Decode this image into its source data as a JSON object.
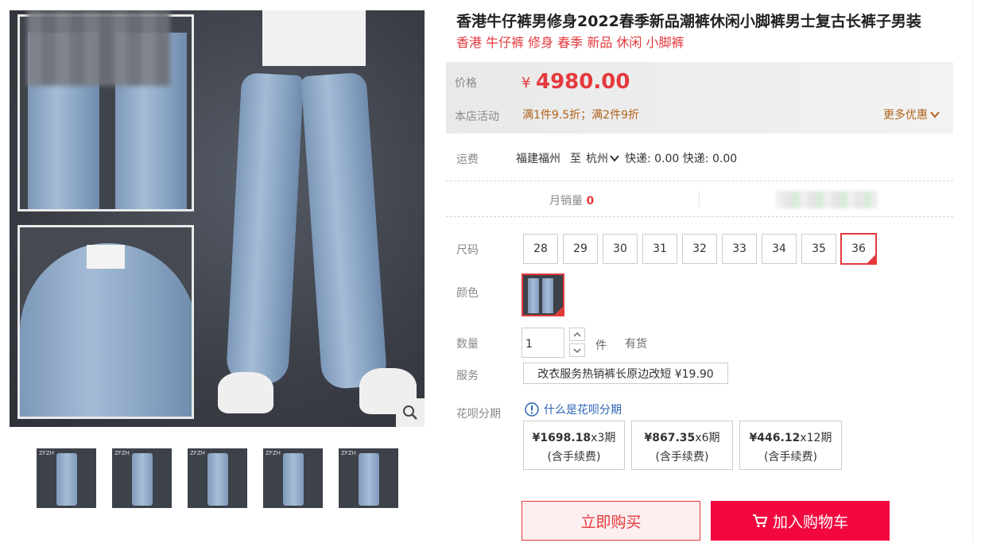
{
  "product": {
    "title": "香港牛仔裤男修身2022春季新品潮裤休闲小脚裤男士复古长裤子男装",
    "subtitle": "香港 牛仔裤 修身 春季 新品 休闲 小脚裤"
  },
  "price": {
    "label": "价格",
    "currency": "¥",
    "value": "4980.00",
    "activity_label": "本店活动",
    "activity_text": "满1件9.5折；满2件9折",
    "more_deals": "更多优惠"
  },
  "shipping": {
    "label": "运费",
    "from": "福建福州",
    "to_word": "至",
    "destination": "杭州",
    "fee_text": "快递: 0.00 快递: 0.00"
  },
  "sales": {
    "label": "月销量",
    "count": "0"
  },
  "sizes": {
    "label": "尺码",
    "options": [
      "28",
      "29",
      "30",
      "31",
      "32",
      "33",
      "34",
      "35",
      "36"
    ],
    "selected": "36"
  },
  "color": {
    "label": "颜色"
  },
  "quantity": {
    "label": "数量",
    "value": "1",
    "unit": "件",
    "stock": "有货"
  },
  "service": {
    "label": "服务",
    "option": "改衣服务热销裤长原边改短 ¥19.90"
  },
  "huabei": {
    "label": "花呗分期",
    "link": "什么是花呗分期",
    "options": [
      {
        "amount": "¥1698.18",
        "period": "x3期",
        "note": "(含手续费)"
      },
      {
        "amount": "¥867.35",
        "period": "x6期",
        "note": "(含手续费)"
      },
      {
        "amount": "¥446.12",
        "period": "x12期",
        "note": "(含手续费)"
      }
    ]
  },
  "actions": {
    "buy_now": "立即购买",
    "add_cart": "加入购物车"
  },
  "thumbnails": {
    "label": "ZFZH"
  },
  "colors": {
    "accent": "#e4393c",
    "cart": "#f2083f",
    "promo": "#b0631b",
    "link": "#2c64b4"
  }
}
